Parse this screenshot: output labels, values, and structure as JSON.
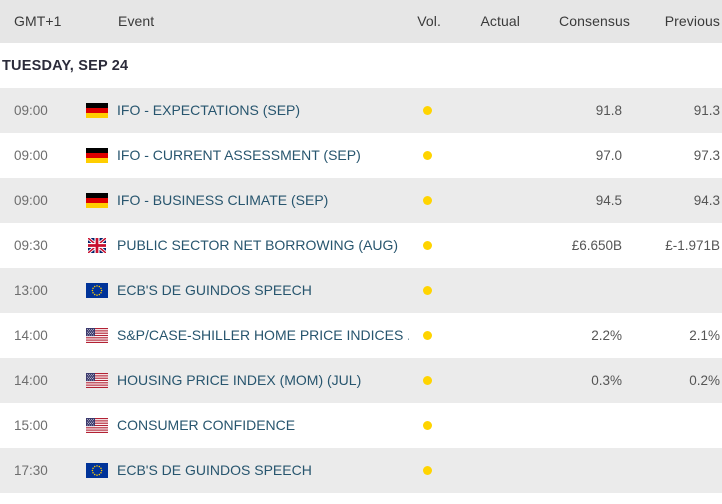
{
  "table": {
    "columns": {
      "time": "GMT+1",
      "event": "Event",
      "volatility": "Vol.",
      "actual": "Actual",
      "consensus": "Consensus",
      "previous": "Previous"
    },
    "date_header": "TUESDAY, SEP 24",
    "volatility_color": "#ffd400",
    "event_link_color": "#27556e",
    "header_background": "#e6e6e6",
    "row_shaded_background": "#ebebeb",
    "rows": [
      {
        "time": "09:00",
        "flag": "flag-germany",
        "country": "Germany",
        "event": "IFO - EXPECTATIONS (SEP)",
        "volatility": "low",
        "actual": "",
        "consensus": "91.8",
        "previous": "91.3"
      },
      {
        "time": "09:00",
        "flag": "flag-germany",
        "country": "Germany",
        "event": "IFO - CURRENT ASSESSMENT (SEP)",
        "volatility": "low",
        "actual": "",
        "consensus": "97.0",
        "previous": "97.3"
      },
      {
        "time": "09:00",
        "flag": "flag-germany",
        "country": "Germany",
        "event": "IFO - BUSINESS CLIMATE (SEP)",
        "volatility": "low",
        "actual": "",
        "consensus": "94.5",
        "previous": "94.3"
      },
      {
        "time": "09:30",
        "flag": "flag-united-kingdom",
        "country": "United Kingdom",
        "event": "PUBLIC SECTOR NET BORROWING (AUG)",
        "volatility": "low",
        "actual": "",
        "consensus": "£6.650B",
        "previous": "£-1.971B"
      },
      {
        "time": "13:00",
        "flag": "flag-european-union",
        "country": "European Union",
        "event": "ECB'S DE GUINDOS SPEECH",
        "volatility": "low",
        "actual": "",
        "consensus": "",
        "previous": ""
      },
      {
        "time": "14:00",
        "flag": "flag-united-states",
        "country": "United States",
        "event": "S&P/CASE-SHILLER HOME PRICE INDICES ...",
        "volatility": "low",
        "actual": "",
        "consensus": "2.2%",
        "previous": "2.1%"
      },
      {
        "time": "14:00",
        "flag": "flag-united-states",
        "country": "United States",
        "event": "HOUSING PRICE INDEX (MOM) (JUL)",
        "volatility": "low",
        "actual": "",
        "consensus": "0.3%",
        "previous": "0.2%"
      },
      {
        "time": "15:00",
        "flag": "flag-united-states",
        "country": "United States",
        "event": "CONSUMER CONFIDENCE",
        "volatility": "low",
        "actual": "",
        "consensus": "",
        "previous": ""
      },
      {
        "time": "17:30",
        "flag": "flag-european-union",
        "country": "European Union",
        "event": "ECB'S DE GUINDOS SPEECH",
        "volatility": "low",
        "actual": "",
        "consensus": "",
        "previous": ""
      }
    ]
  }
}
